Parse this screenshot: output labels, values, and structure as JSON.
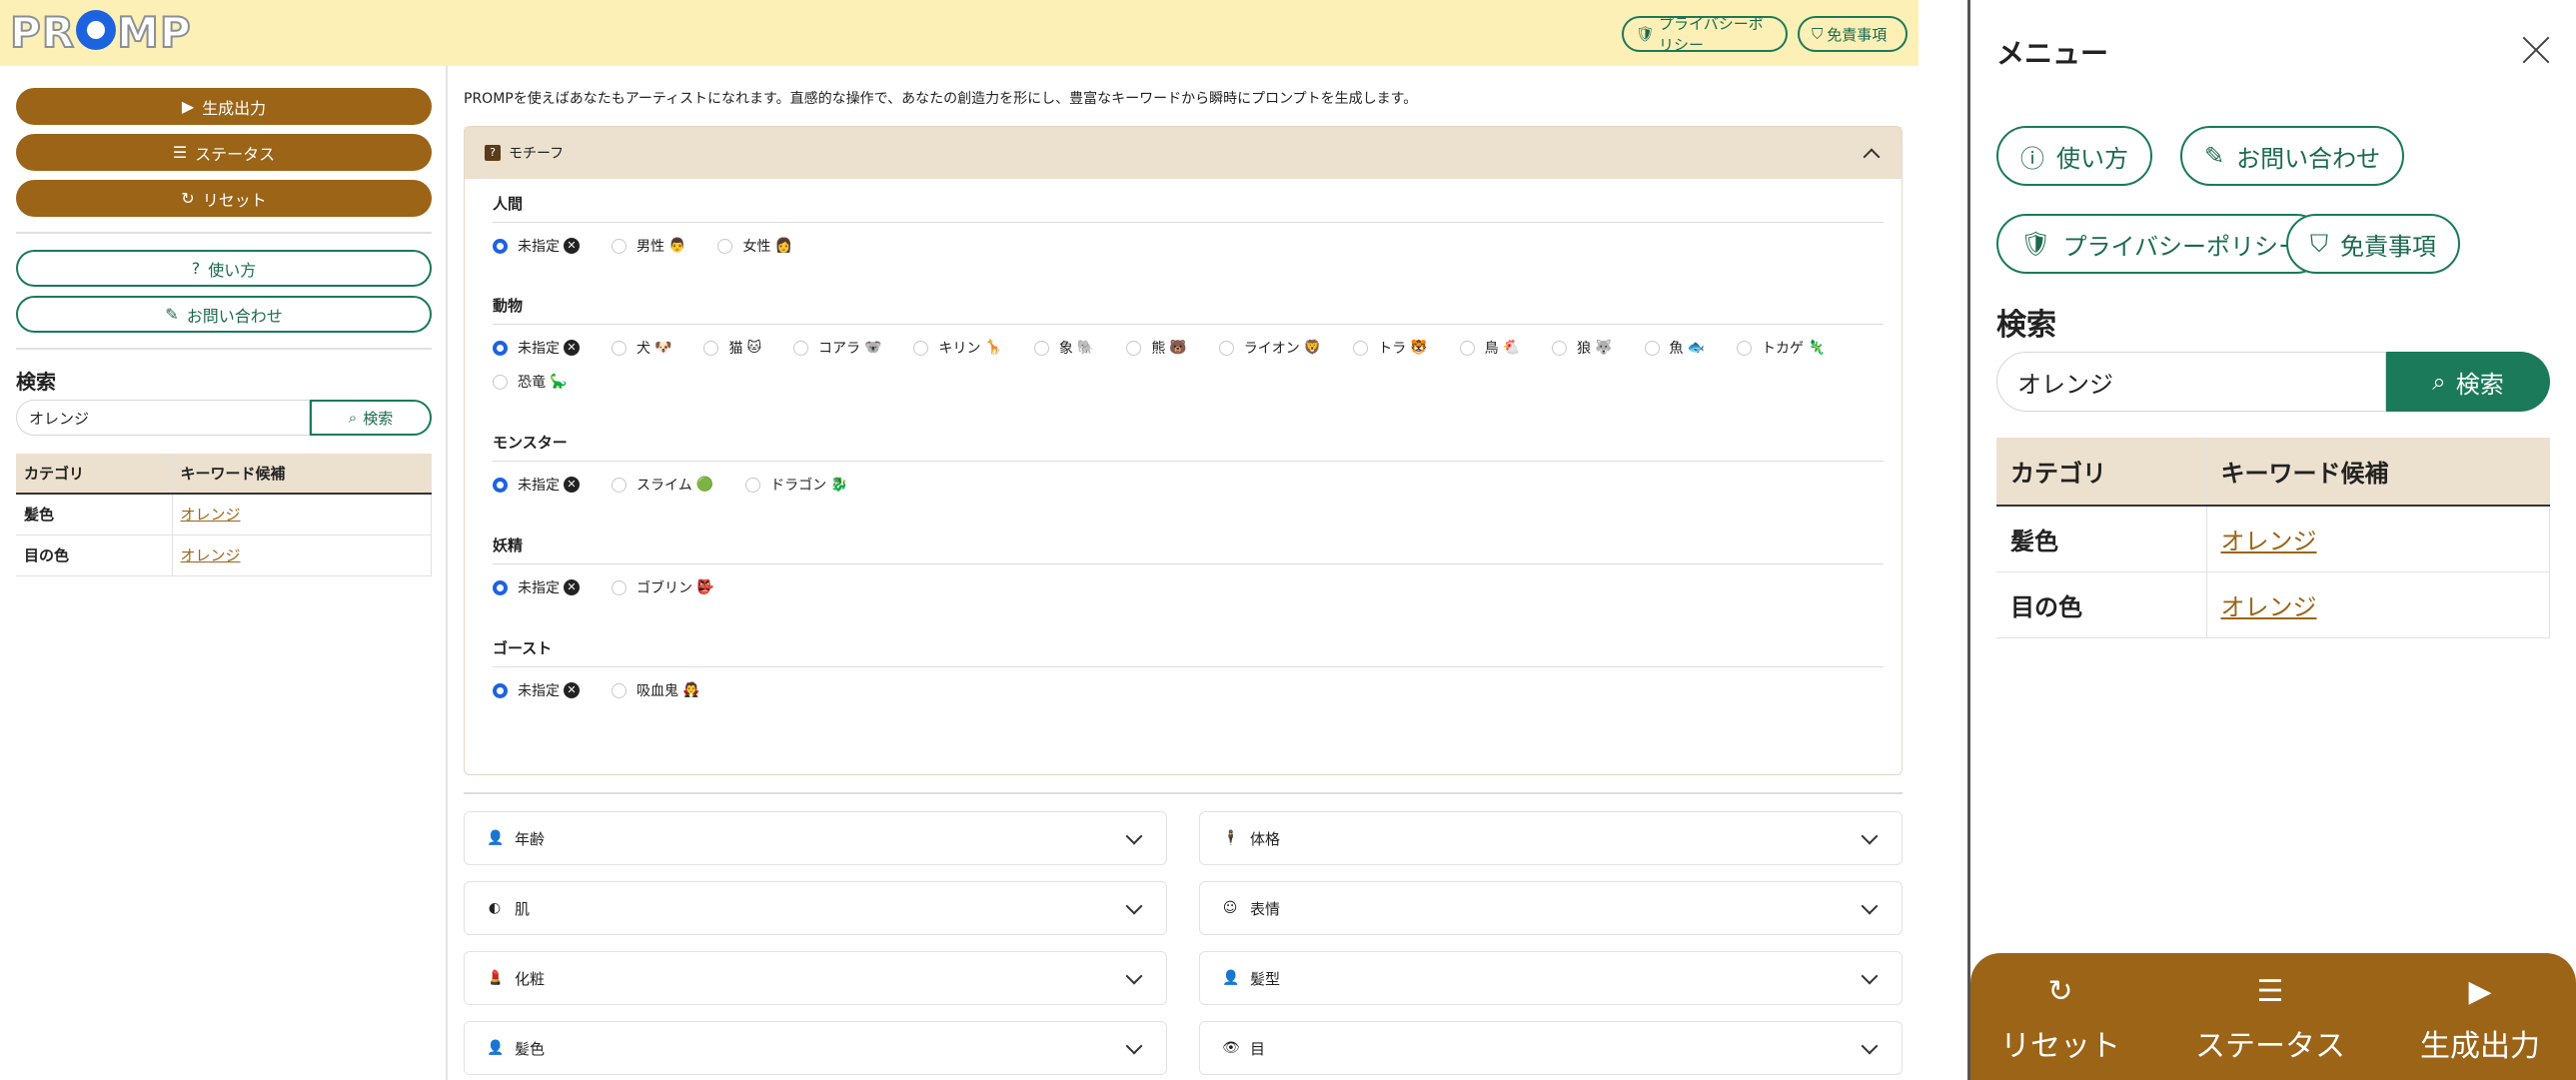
{
  "header": {
    "logo": "PROMP",
    "privacy_label": "プライバシーポリシー",
    "disclaimer_label": "免責事項"
  },
  "sidebar": {
    "generate_label": "生成出力",
    "status_label": "ステータス",
    "reset_label": "リセット",
    "howto_label": "使い方",
    "contact_label": "お問い合わせ",
    "search_title": "検索",
    "search_value": "オレンジ",
    "search_button": "検索",
    "table": {
      "headers": [
        "カテゴリ",
        "キーワード候補"
      ],
      "rows": [
        {
          "category": "髪色",
          "keyword": "オレンジ"
        },
        {
          "category": "目の色",
          "keyword": "オレンジ"
        }
      ]
    }
  },
  "main": {
    "intro": "PROMPを使えばあなたもアーティストになれます。直感的な操作で、あなたの創造力を形にし、豊富なキーワードから瞬時にプロンプトを生成します。",
    "motif": {
      "title": "モチーフ",
      "icon": "question-icon",
      "groups": [
        {
          "title": "人間",
          "options": [
            {
              "label": "未指定",
              "emoji": "⊗",
              "checked": true
            },
            {
              "label": "男性",
              "emoji": "👨"
            },
            {
              "label": "女性",
              "emoji": "👩"
            }
          ]
        },
        {
          "title": "動物",
          "options": [
            {
              "label": "未指定",
              "emoji": "⊗",
              "checked": true
            },
            {
              "label": "犬",
              "emoji": "🐶"
            },
            {
              "label": "猫",
              "emoji": "🐱"
            },
            {
              "label": "コアラ",
              "emoji": "🐨"
            },
            {
              "label": "キリン",
              "emoji": "🦒"
            },
            {
              "label": "象",
              "emoji": "🐘"
            },
            {
              "label": "熊",
              "emoji": "🐻"
            },
            {
              "label": "ライオン",
              "emoji": "🦁"
            },
            {
              "label": "トラ",
              "emoji": "🐯"
            },
            {
              "label": "鳥",
              "emoji": "🐔"
            },
            {
              "label": "狼",
              "emoji": "🐺"
            },
            {
              "label": "魚",
              "emoji": "🐟"
            },
            {
              "label": "トカゲ",
              "emoji": "🦎"
            },
            {
              "label": "恐竜",
              "emoji": "🦕"
            }
          ]
        },
        {
          "title": "モンスター",
          "options": [
            {
              "label": "未指定",
              "emoji": "⊗",
              "checked": true
            },
            {
              "label": "スライム",
              "emoji": "🟢"
            },
            {
              "label": "ドラゴン",
              "emoji": "🐉"
            }
          ]
        },
        {
          "title": "妖精",
          "options": [
            {
              "label": "未指定",
              "emoji": "⊗",
              "checked": true
            },
            {
              "label": "ゴブリン",
              "emoji": "👺"
            }
          ]
        },
        {
          "title": "ゴースト",
          "options": [
            {
              "label": "未指定",
              "emoji": "⊗",
              "checked": true
            },
            {
              "label": "吸血鬼",
              "emoji": "🧛"
            }
          ]
        }
      ]
    },
    "collapsed": [
      {
        "label": "年齢",
        "icon": "person-icon"
      },
      {
        "label": "体格",
        "icon": "figure-icon"
      },
      {
        "label": "肌",
        "icon": "moon-icon"
      },
      {
        "label": "表情",
        "icon": "smile-icon"
      },
      {
        "label": "化粧",
        "icon": "makeup-icon"
      },
      {
        "label": "髪型",
        "icon": "hairstyle-icon"
      },
      {
        "label": "髪色",
        "icon": "haircolor-icon"
      },
      {
        "label": "目",
        "icon": "eye-icon"
      }
    ]
  },
  "menu": {
    "title": "メニュー",
    "howto_label": "使い方",
    "contact_label": "お問い合わせ",
    "privacy_label": "プライバシーポリシー",
    "disclaimer_label": "免責事項",
    "search_title": "検索",
    "search_value": "オレンジ",
    "search_button": "検索",
    "table": {
      "headers": [
        "カテゴリ",
        "キーワード候補"
      ],
      "rows": [
        {
          "category": "髪色",
          "keyword": "オレンジ"
        },
        {
          "category": "目の色",
          "keyword": "オレンジ"
        }
      ]
    },
    "bottom_nav": {
      "reset_label": "リセット",
      "status_label": "ステータス",
      "generate_label": "生成出力"
    }
  },
  "colors": {
    "brand_brown": "#9b6417",
    "accent_green": "#1a7a5a",
    "header_yellow": "#fdf0b6",
    "table_header": "#ece0cf"
  }
}
